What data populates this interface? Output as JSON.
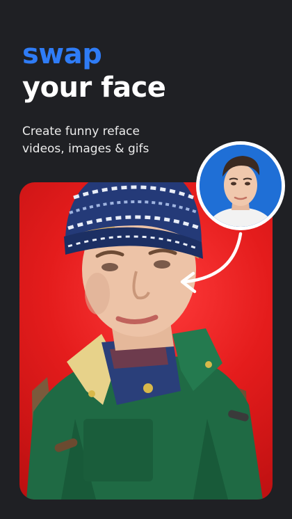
{
  "headline": {
    "accent": "swap",
    "main": "your face"
  },
  "subtitle": {
    "line1": "Create funny reface",
    "line2": "videos, images & gifs"
  },
  "colors": {
    "background": "#1f2024",
    "accent": "#2f7cf6",
    "card_red": "#e41c1c",
    "avatar_blue": "#1f6fd6",
    "coat_green": "#1f6a44",
    "beanie_navy": "#243a78"
  },
  "icons": {
    "arrow": "curved-arrow-icon"
  }
}
